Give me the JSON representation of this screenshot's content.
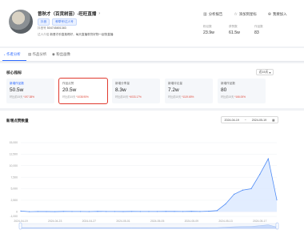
{
  "profile": {
    "name": "曾秋才（百货树苗）-旺旺直播",
    "tags": [
      "抖音",
      "种草号/达人号"
    ],
    "meta1_label": "抖音号",
    "meta1_value": "504745801383",
    "meta2_label": "达人介绍",
    "meta2_value": "新晋才秒直抱得好，每天直播带货好物一起快直播"
  },
  "actions": [
    {
      "icon": "chart-icon",
      "glyph": "▥",
      "label": "分析报告"
    },
    {
      "icon": "star-icon",
      "glyph": "☆",
      "label": "添加到星标"
    },
    {
      "icon": "join-icon",
      "glyph": "⊕",
      "label": "我要加入"
    }
  ],
  "stats": [
    {
      "label": "粉丝数",
      "value": "23.9w"
    },
    {
      "label": "获赞数",
      "value": "61.5w"
    },
    {
      "label": "作品数",
      "value": "83"
    }
  ],
  "tabs": [
    {
      "label": "作者分析",
      "icon_glyph": "◔"
    },
    {
      "label": "作品分析",
      "icon_glyph": "▤"
    },
    {
      "label": "粉丝画像",
      "icon_glyph": "◉"
    }
  ],
  "core": {
    "title": "核心指标",
    "range": "近15天",
    "cards": [
      {
        "label": "新增作品数",
        "value": "50.5w",
        "compare_label": "环比前15天",
        "compare_pct": "*197.38%"
      },
      {
        "label": "作品点赞",
        "value": "20.5w",
        "compare_label": "环比前15天",
        "compare_pct": "*1038.95%"
      },
      {
        "label": "新增分享量",
        "value": "8.3w",
        "compare_label": "环比前15天",
        "compare_pct": "*4033.17%"
      },
      {
        "label": "新增评论量",
        "value": "7.2w",
        "compare_label": "环比前15天",
        "compare_pct": "*1119.65%"
      },
      {
        "label": "新增作品数",
        "value": "80",
        "compare_label": "环比前15天",
        "compare_pct": "*166.00%"
      }
    ]
  },
  "chart_panel": {
    "title": "新增点赞数量",
    "date_start": "2024-04-19",
    "date_sep": "~",
    "date_end": "2024-05-19"
  },
  "chart_data": {
    "type": "area",
    "title": "新增点赞数量",
    "ylim": [
      -1000,
      15000
    ],
    "yticks": [
      "15,000",
      "12,500",
      "10,000",
      "7,500",
      "5,000",
      "2,500",
      "0",
      "-1,000"
    ],
    "ytick_values": [
      15000,
      12500,
      10000,
      7500,
      5000,
      2500,
      0,
      -1000
    ],
    "x": [
      "2024-04-19",
      "2024-04-20",
      "2024-04-21",
      "2024-04-22",
      "2024-04-23",
      "2024-04-24",
      "2024-04-25",
      "2024-04-26",
      "2024-04-27",
      "2024-04-28",
      "2024-04-29",
      "2024-04-30",
      "2024-05-01",
      "2024-05-02",
      "2024-05-03",
      "2024-05-04",
      "2024-05-05",
      "2024-05-06",
      "2024-05-07",
      "2024-05-08",
      "2024-05-09",
      "2024-05-10",
      "2024-05-11",
      "2024-05-12",
      "2024-05-13",
      "2024-05-14",
      "2024-05-15",
      "2024-05-16",
      "2024-05-17",
      "2024-05-18",
      "2024-05-19"
    ],
    "xticks": [
      "2024-04-19",
      "2024-04-23",
      "2024-04-27",
      "2024-05-01",
      "2024-05-05",
      "2024-05-09",
      "2024-05-13",
      "2024-05-17"
    ],
    "series": [
      {
        "values": [
          150,
          20,
          60,
          50,
          30,
          80,
          70,
          60,
          40,
          90,
          70,
          60,
          50,
          80,
          60,
          70,
          60,
          90,
          80,
          70,
          100,
          60,
          120,
          250,
          1700,
          3800,
          4700,
          5000,
          8100,
          11500,
          2600
        ]
      }
    ],
    "colors": {
      "line": "#4f8bf5",
      "fill": "#dbe8ff",
      "grid": "#eef0f3"
    }
  }
}
